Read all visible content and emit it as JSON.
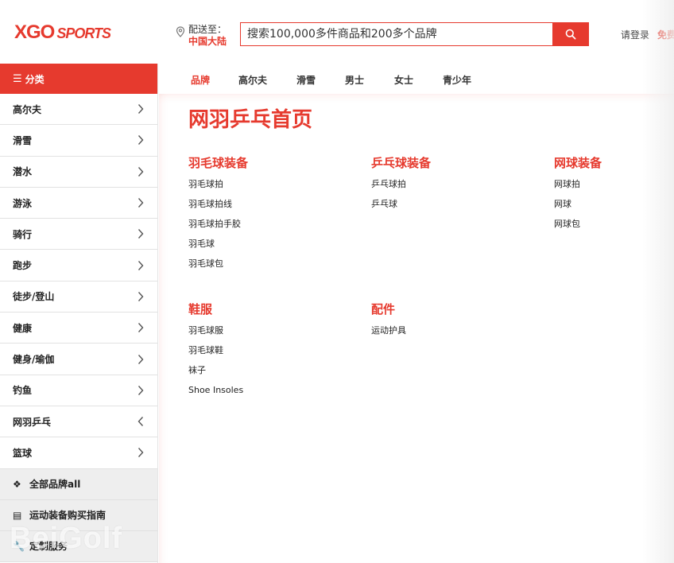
{
  "header": {
    "logo_main": "XGO",
    "logo_sub": "SPORTS",
    "ship_label": "配送至：",
    "ship_region": "中国大陆",
    "search_placeholder": "搜索100,000多件商品和200多个品牌",
    "login": "请登录",
    "free": "免费"
  },
  "sidebar": {
    "header": "分类",
    "items": [
      {
        "label": "高尔夫",
        "chevron": "right"
      },
      {
        "label": "滑雪",
        "chevron": "right"
      },
      {
        "label": "潜水",
        "chevron": "right"
      },
      {
        "label": "游泳",
        "chevron": "right"
      },
      {
        "label": "骑行",
        "chevron": "right"
      },
      {
        "label": "跑步",
        "chevron": "right"
      },
      {
        "label": "徒步/登山",
        "chevron": "right"
      },
      {
        "label": "健康",
        "chevron": "right"
      },
      {
        "label": "健身/瑜伽",
        "chevron": "right"
      },
      {
        "label": "钓鱼",
        "chevron": "right"
      },
      {
        "label": "网羽乒乓",
        "chevron": "left"
      },
      {
        "label": "篮球",
        "chevron": "right"
      }
    ],
    "extras": [
      {
        "label": "全部品牌all",
        "icon": "brands-icon"
      },
      {
        "label": "运动装备购买指南",
        "icon": "guide-icon"
      },
      {
        "label": "定制服务",
        "icon": "wrench-icon"
      }
    ],
    "watermark": "BeiGolf"
  },
  "tabs": [
    {
      "label": "品牌",
      "active": true
    },
    {
      "label": "高尔夫",
      "active": false
    },
    {
      "label": "滑雪",
      "active": false
    },
    {
      "label": "男士",
      "active": false
    },
    {
      "label": "女士",
      "active": false
    },
    {
      "label": "青少年",
      "active": false
    }
  ],
  "main": {
    "title": "网羽乒乓首页",
    "groups": [
      {
        "title": "羽毛球装备",
        "links": [
          "羽毛球拍",
          "羽毛球拍线",
          "羽毛球拍手胶",
          "羽毛球",
          "羽毛球包"
        ]
      },
      {
        "title": "乒乓球装备",
        "links": [
          "乒乓球拍",
          "乒乓球"
        ]
      },
      {
        "title": "网球装备",
        "links": [
          "网球拍",
          "网球",
          "网球包"
        ]
      },
      {
        "title": "鞋服",
        "links": [
          "羽毛球服",
          "羽毛球鞋",
          "袜子",
          "Shoe Insoles"
        ]
      },
      {
        "title": "配件",
        "links": [
          "运动护具"
        ]
      }
    ]
  },
  "colors": {
    "accent": "#e63a2e"
  }
}
